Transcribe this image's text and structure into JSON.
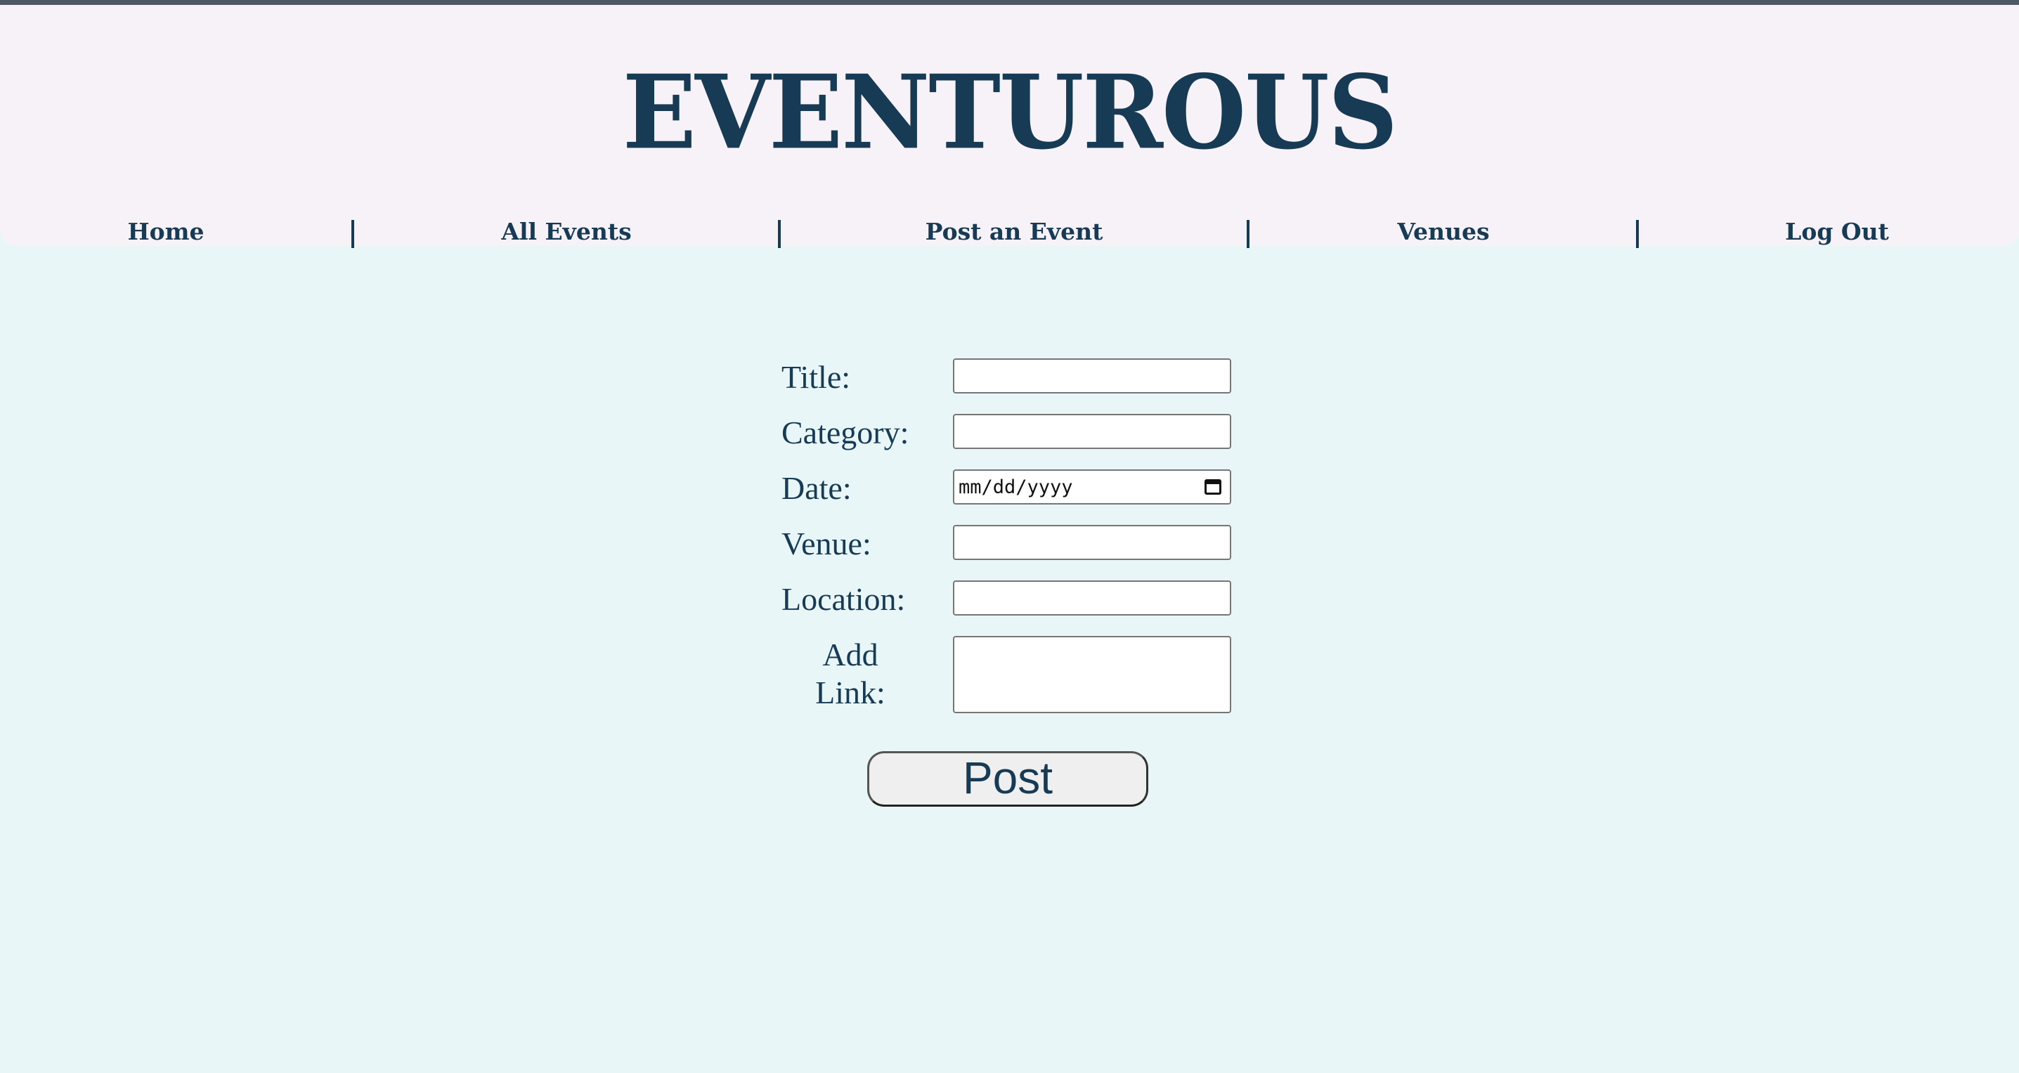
{
  "app": {
    "logo_text": "EVENTUROUS"
  },
  "nav": {
    "items": [
      {
        "label": "Home"
      },
      {
        "label": "All Events"
      },
      {
        "label": "Post an Event"
      },
      {
        "label": "Venues"
      },
      {
        "label": "Log Out"
      }
    ]
  },
  "form": {
    "title_label": "Title:",
    "title_value": "",
    "category_label": "Category:",
    "category_value": "",
    "date_label": "Date:",
    "date_placeholder": "mm/dd/yyyy",
    "date_icon": "calendar-icon",
    "venue_label": "Venue:",
    "venue_value": "",
    "location_label": "Location:",
    "location_value": "",
    "link_label_line1": "Add",
    "link_label_line2": "Link:",
    "link_value": "",
    "submit_label": "Post"
  },
  "colors": {
    "brand": "#183b55",
    "page_background": "#e8f6f7",
    "header_background": "#f7f1f8"
  }
}
